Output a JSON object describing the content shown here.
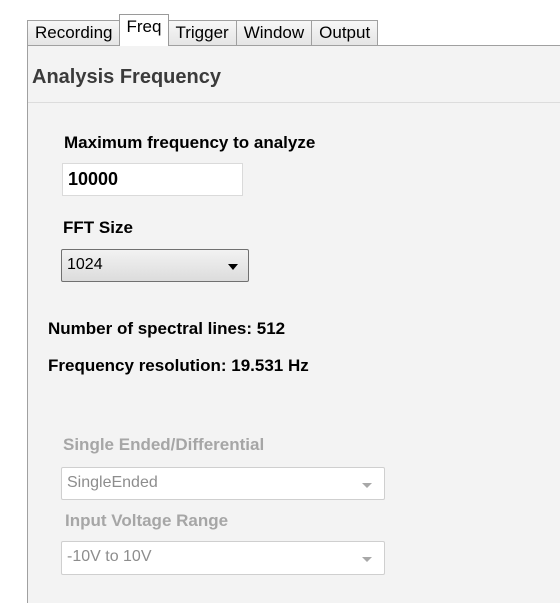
{
  "tabs": [
    {
      "label": "Recording",
      "active": false
    },
    {
      "label": "Freq",
      "active": true
    },
    {
      "label": "Trigger",
      "active": false
    },
    {
      "label": "Window",
      "active": false
    },
    {
      "label": "Output",
      "active": false
    }
  ],
  "section": {
    "title": "Analysis Frequency"
  },
  "max_freq": {
    "label": "Maximum frequency to analyze",
    "value": "10000"
  },
  "fft": {
    "label": "FFT Size",
    "selected": "1024"
  },
  "info": {
    "spectral_lines": "Number of spectral lines: 512",
    "resolution": "Frequency resolution: 19.531 Hz"
  },
  "single_ended": {
    "label": "Single Ended/Differential",
    "selected": "SingleEnded",
    "enabled": false
  },
  "voltage_range": {
    "label": "Input Voltage Range",
    "selected": "-10V to 10V",
    "enabled": false
  },
  "colors": {
    "panel_bg": "#f3f3f3",
    "disabled_text": "#a6a6a6",
    "tab_border": "#a0a0a0"
  }
}
